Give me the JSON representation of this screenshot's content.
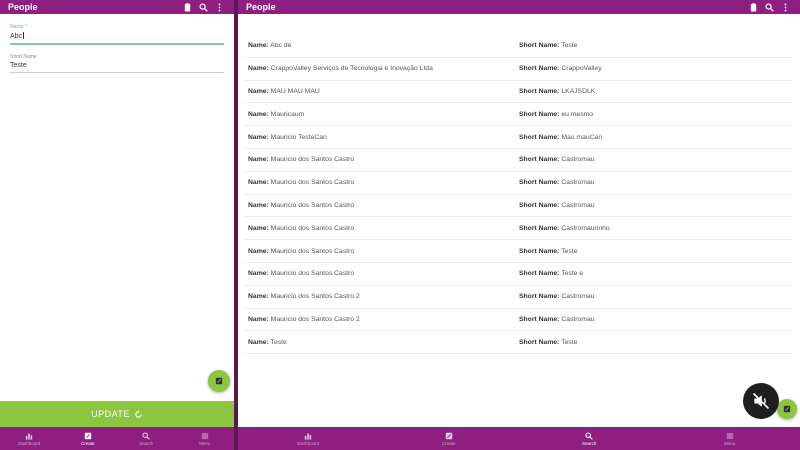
{
  "left": {
    "title": "People",
    "name_label": "Name *",
    "name_value": "Abc",
    "short_label": "Short Name",
    "short_value": "Teste",
    "update_label": "UPDATE"
  },
  "right": {
    "title": "People",
    "name_prefix": "Name:",
    "short_prefix": "Short Name:",
    "rows": [
      {
        "name": "Abc de",
        "short": "Teste"
      },
      {
        "name": "CrappoValley Serviços de Tecnologia e Inovação Ltda",
        "short": "CrappoValley"
      },
      {
        "name": "MAU MAU MAU",
        "short": "LKAJSDLK"
      },
      {
        "name": "Mauricaum",
        "short": "eu mesmo"
      },
      {
        "name": "Mauricio TesteCan",
        "short": "Mau mauCan"
      },
      {
        "name": "Mauricio dos Santos Castro",
        "short": "Castromau"
      },
      {
        "name": "Mauricio dos Santos Castro",
        "short": "Castromau"
      },
      {
        "name": "Mauricio dos Santos Castro",
        "short": "Castromau"
      },
      {
        "name": "Mauricio dos Santos Castro",
        "short": "Castromaurinho"
      },
      {
        "name": "Mauricio dos Santos Castro",
        "short": "Teste"
      },
      {
        "name": "Mauricio dos Santos Castro",
        "short": "Teste e"
      },
      {
        "name": "Mauricio dos Santos Castro 2",
        "short": "Castromau"
      },
      {
        "name": "Mauricio dos Santos Castro 2",
        "short": "Castromau"
      },
      {
        "name": "Teste",
        "short": "Teste"
      }
    ]
  },
  "nav": [
    {
      "label": "Dashboard",
      "icon": "chart-icon"
    },
    {
      "label": "Create",
      "icon": "create-icon"
    },
    {
      "label": "Search",
      "icon": "search-icon"
    },
    {
      "label": "Menu",
      "icon": "menu-icon"
    }
  ],
  "colors": {
    "primary": "#8e1f81",
    "accent": "#8cc63f"
  }
}
